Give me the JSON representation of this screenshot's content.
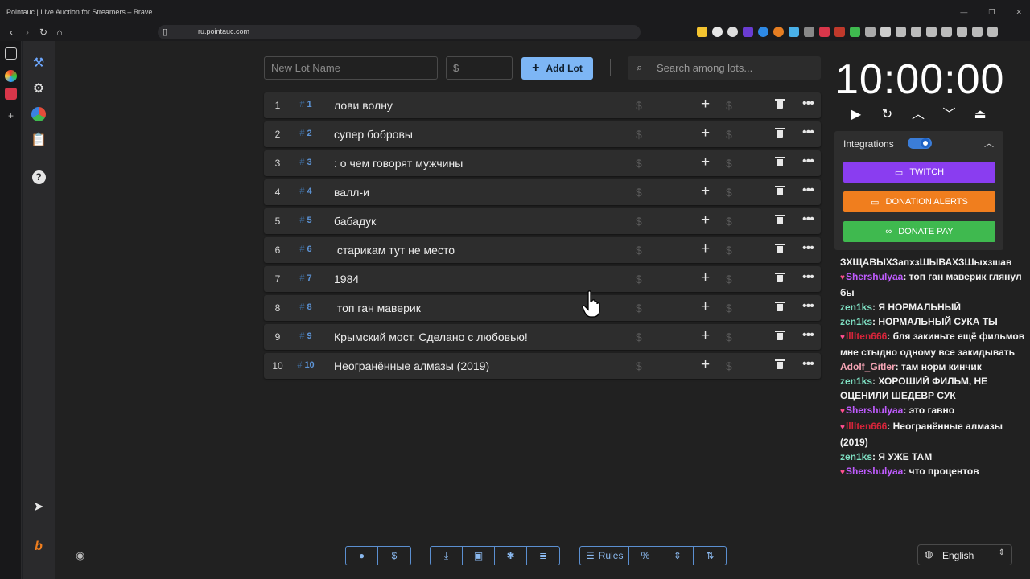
{
  "browser": {
    "window_title": "Pointauc | Live Auction for Streamers – Brave",
    "url": "ru.pointauc.com"
  },
  "topbar": {
    "lot_name_placeholder": "New Lot Name",
    "amount_placeholder": "$",
    "add_lot_label": "Add Lot",
    "search_placeholder": "Search among lots..."
  },
  "lots": [
    {
      "num": "1",
      "id": "1",
      "name": "лови волну"
    },
    {
      "num": "2",
      "id": "2",
      "name": "супер бобровы"
    },
    {
      "num": "3",
      "id": "3",
      "name": ": о чем говорят мужчины"
    },
    {
      "num": "4",
      "id": "4",
      "name": "валл-и"
    },
    {
      "num": "5",
      "id": "5",
      "name": "бабадук"
    },
    {
      "num": "6",
      "id": "6",
      "name": " старикам тут не место"
    },
    {
      "num": "7",
      "id": "7",
      "name": "1984"
    },
    {
      "num": "8",
      "id": "8",
      "name": " топ ган маверик"
    },
    {
      "num": "9",
      "id": "9",
      "name": "Крымский мост. Сделано с любовью!"
    },
    {
      "num": "10",
      "id": "10",
      "name": "Неогранённые алмазы (2019)"
    }
  ],
  "lot_row": {
    "currency": "$",
    "plus": "+",
    "more": "•••",
    "hash": "#"
  },
  "timer": {
    "value": "10:00:00"
  },
  "integrations": {
    "label": "Integrations",
    "enabled": true,
    "buttons": [
      {
        "label": "TWITCH",
        "color": "#8a3df0"
      },
      {
        "label": "DONATION ALERTS",
        "color": "#f07e1e"
      },
      {
        "label": "DONATE PAY",
        "color": "#3fb94f"
      }
    ]
  },
  "chat": [
    {
      "user": "",
      "color": "#ffffff",
      "heart": false,
      "text": "ЗХЩАВЫХЗапхзШЫВАХЗШыхзшав"
    },
    {
      "user": "Shershulyaa",
      "color": "#c05cff",
      "heart": true,
      "text": ": топ ган маверик глянул бы"
    },
    {
      "user": "zen1ks",
      "color": "#7fe0c3",
      "heart": false,
      "text": ": Я НОРМАЛЬНЫЙ"
    },
    {
      "user": "zen1ks",
      "color": "#7fe0c3",
      "heart": false,
      "text": ": НОРМАЛЬНЫЙ СУКА ТЫ"
    },
    {
      "user": "llllten666",
      "color": "#d6243a",
      "heart": true,
      "text": ": бля закиньте ещё фильмов мне стыдно одному все закидывать"
    },
    {
      "user": "Adolf_Gitler",
      "color": "#f7a6b6",
      "heart": false,
      "text": ": там норм кинчик"
    },
    {
      "user": "zen1ks",
      "color": "#7fe0c3",
      "heart": false,
      "text": ": ХОРОШИЙ ФИЛЬМ, НЕ ОЦЕНИЛИ ШЕДЕВР СУК"
    },
    {
      "user": "Shershulyaa",
      "color": "#c05cff",
      "heart": true,
      "text": ": это гавно"
    },
    {
      "user": "llllten666",
      "color": "#d6243a",
      "heart": true,
      "text": ": Неогранённые алмазы (2019)"
    },
    {
      "user": "zen1ks",
      "color": "#7fe0c3",
      "heart": false,
      "text": ": Я УЖЕ ТАМ"
    },
    {
      "user": "Shershulyaa",
      "color": "#c05cff",
      "heart": true,
      "text": ": что процентов"
    }
  ],
  "bottom": {
    "rules_label": "Rules",
    "language": "English"
  },
  "colors": {
    "accent": "#7db6f5",
    "bottom_border": "#5b8fd0"
  }
}
